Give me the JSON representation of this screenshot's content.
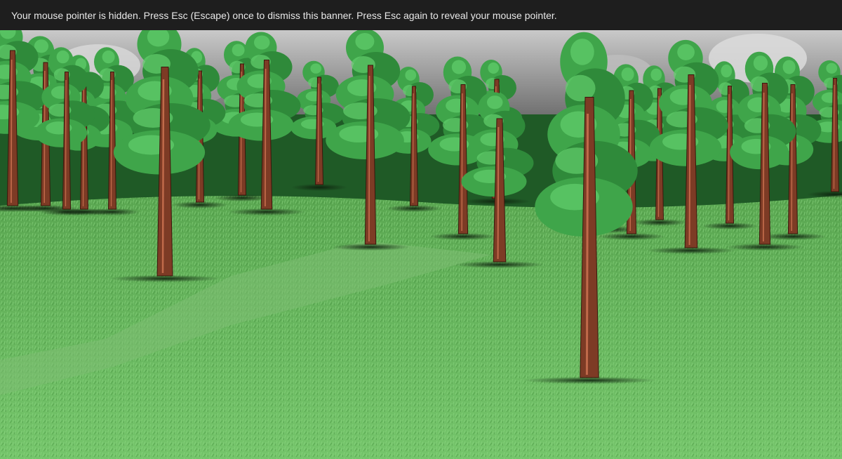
{
  "banner": {
    "message": "Your mouse pointer is hidden. Press Esc (Escape) once to dismiss this banner. Press Esc again to reveal your mouse pointer."
  },
  "scene": {
    "description_colors": {
      "sky": "#8e8e8e",
      "grass_light": "#6fc267",
      "grass_dark": "#4f9f48",
      "foliage": "#2e8b3a",
      "foliage_light": "#5cd16a",
      "trunk": "#7a3a26"
    }
  }
}
